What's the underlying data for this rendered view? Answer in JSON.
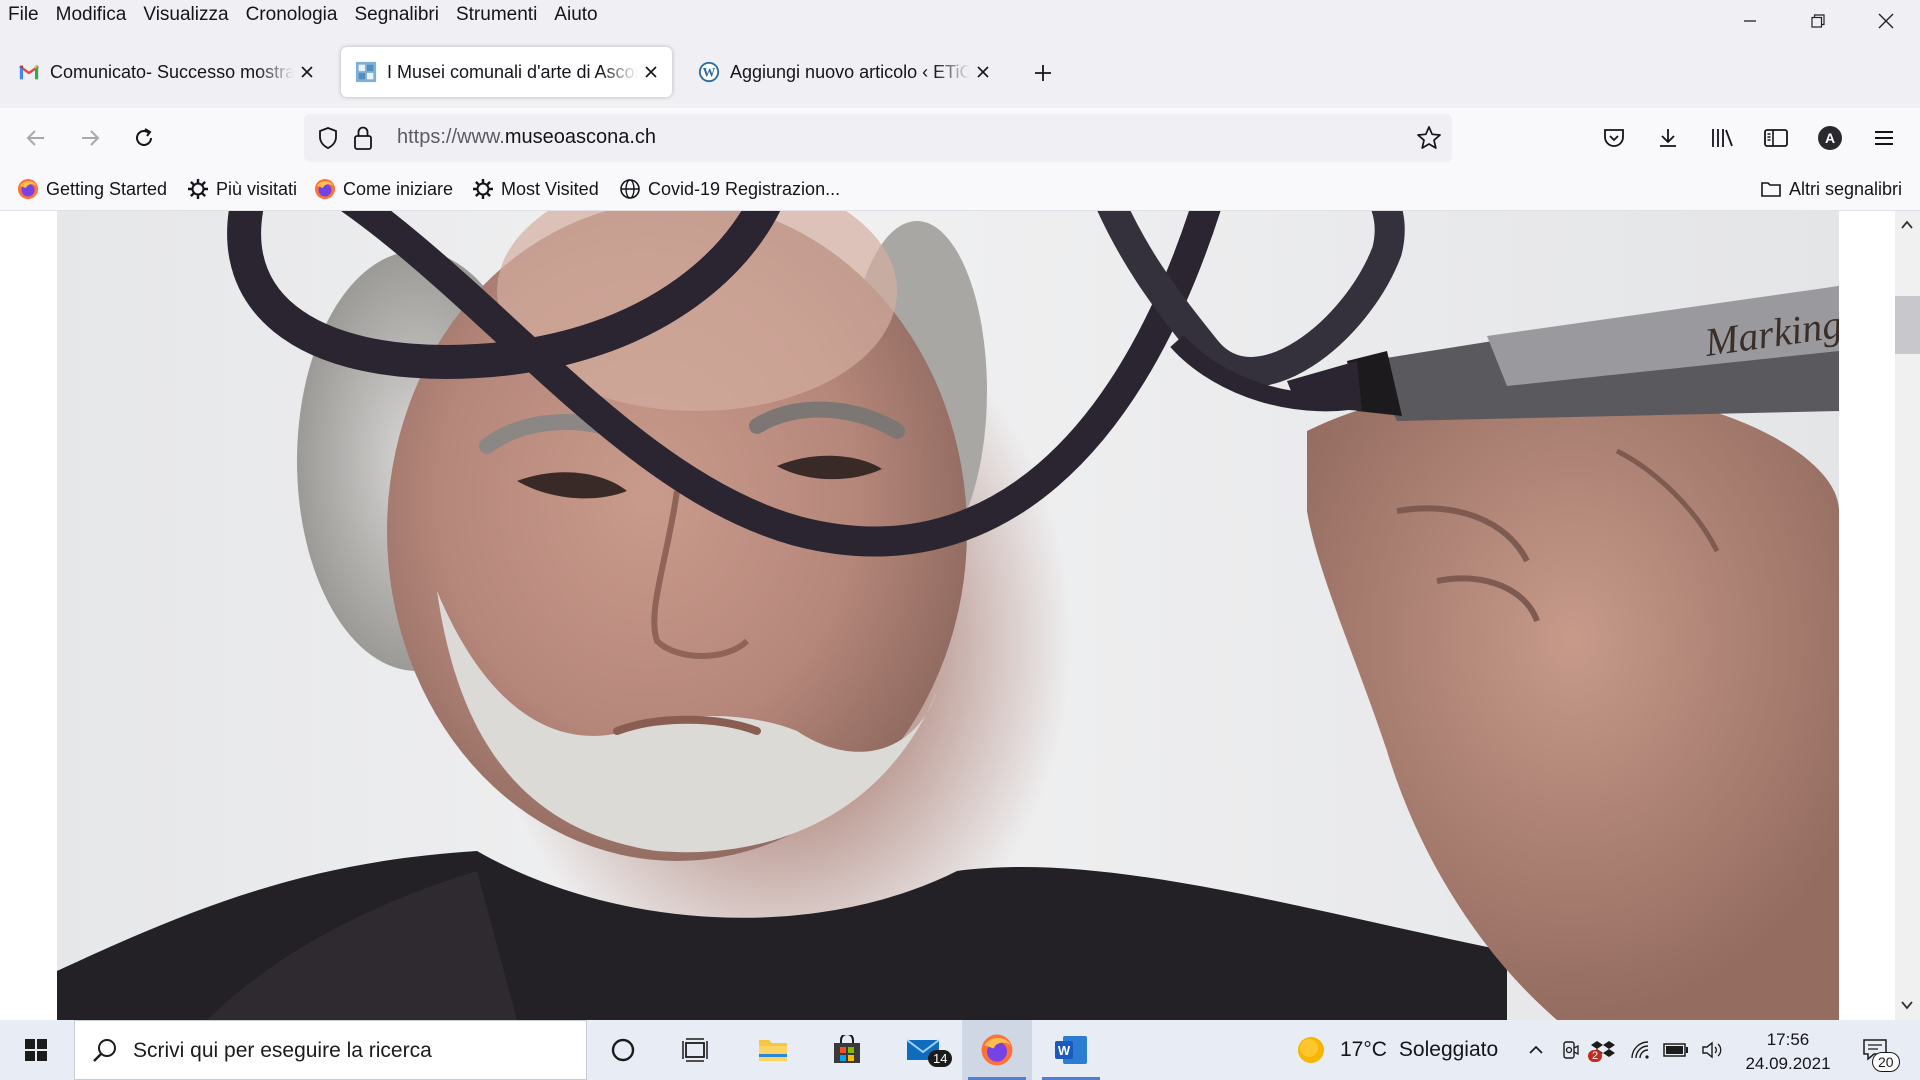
{
  "menu": [
    "File",
    "Modifica",
    "Visualizza",
    "Cronologia",
    "Segnalibri",
    "Strumenti",
    "Aiuto"
  ],
  "tabs": [
    {
      "title": "Comunicato- Successo mostra di Bisoni",
      "icon": "gmail-icon",
      "active": false
    },
    {
      "title": "I Musei comunali d'arte di Ascona",
      "icon": "museum-favicon-icon",
      "active": true
    },
    {
      "title": "Aggiungi nuovo articolo ‹ ETiCinfo",
      "icon": "wordpress-icon",
      "active": false
    }
  ],
  "url": {
    "prefix": "https://www.",
    "domain": "museoascona.ch"
  },
  "bookmarks": [
    {
      "label": "Getting Started",
      "icon": "firefox-icon"
    },
    {
      "label": "Più visitati",
      "icon": "gear-icon"
    },
    {
      "label": "Come iniziare",
      "icon": "firefox-icon"
    },
    {
      "label": "Most Visited",
      "icon": "gear-icon"
    },
    {
      "label": "Covid-19 Registrazion...",
      "icon": "globe-icon"
    }
  ],
  "other_bookmarks": "Altri segnalibri",
  "profile_initial": "A",
  "taskbar": {
    "search_placeholder": "Scrivi qui per eseguire la ricerca",
    "mail_badge": "14",
    "weather_temp": "17°C",
    "weather_text": "Soleggiato",
    "time": "17:56",
    "date": "24.09.2021",
    "notifications": "20",
    "tray_badge": "2"
  },
  "photo": {
    "marker_text": "Marking"
  }
}
